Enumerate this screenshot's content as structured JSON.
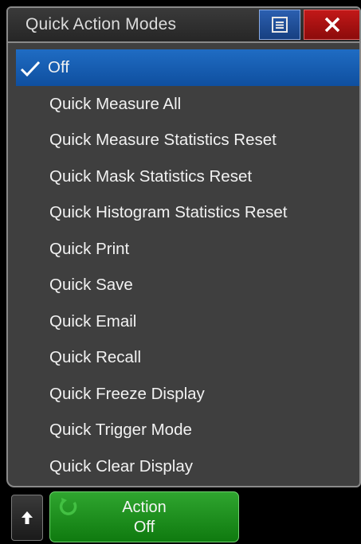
{
  "dialog": {
    "title": "Quick Action Modes",
    "menu_icon": "menu-list-icon",
    "close_icon": "close-icon",
    "items": [
      {
        "label": "Off",
        "selected": true
      },
      {
        "label": "Quick Measure All"
      },
      {
        "label": "Quick Measure Statistics Reset"
      },
      {
        "label": "Quick Mask Statistics Reset"
      },
      {
        "label": "Quick Histogram Statistics Reset"
      },
      {
        "label": "Quick Print"
      },
      {
        "label": "Quick Save"
      },
      {
        "label": "Quick Email"
      },
      {
        "label": "Quick Recall"
      },
      {
        "label": "Quick Freeze Display"
      },
      {
        "label": "Quick Trigger Mode"
      },
      {
        "label": "Quick Clear Display"
      }
    ]
  },
  "softkeys": {
    "up_icon": "arrow-up-icon",
    "action_label": "Action",
    "action_value": "Off",
    "action_icon": "rotate-knob-icon"
  },
  "colors": {
    "selected_bg": "#1a62b8",
    "close_bg": "#b01414",
    "menu_bg": "#22509c",
    "action_bg": "#1f8f1f",
    "dialog_bg": "#3f3f3f"
  }
}
